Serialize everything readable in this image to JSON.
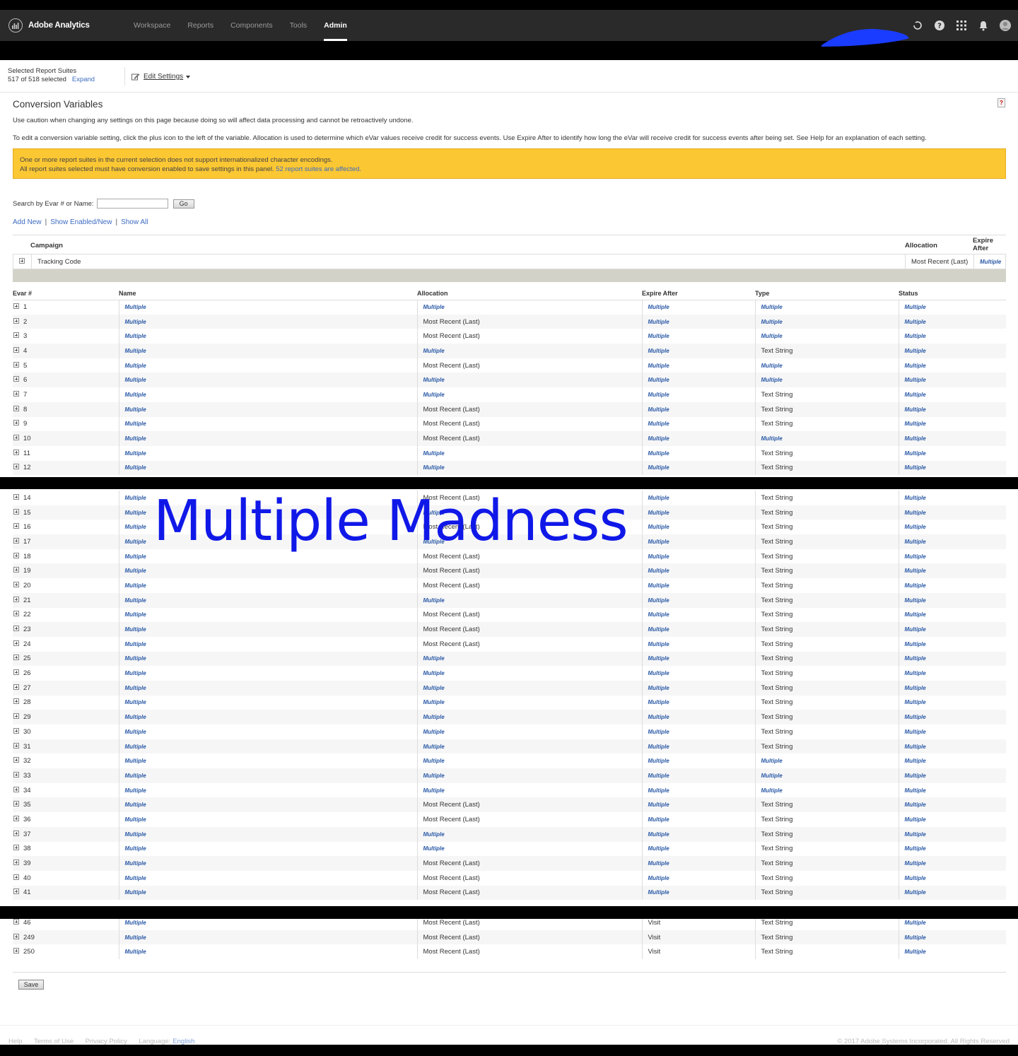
{
  "app": {
    "brand": "Adobe Analytics",
    "nav": [
      "Workspace",
      "Reports",
      "Components",
      "Tools",
      "Admin"
    ],
    "active_nav": "Admin",
    "icons": [
      "help-icon",
      "apps-grid-icon",
      "bell-icon",
      "avatar-icon"
    ]
  },
  "suites": {
    "label": "Selected Report Suites",
    "count": "517 of 518 selected",
    "expand": "Expand",
    "edit_settings": "Edit Settings"
  },
  "page": {
    "title": "Conversion Variables",
    "caution": "Use caution when changing any settings on this page because doing so will affect data processing and cannot be retroactively undone.",
    "instructions": "To edit a conversion variable setting, click the plus icon to the left of the variable. Allocation is used to determine which eVar values receive credit for success events. Use Expire After to identify how long the eVar will receive credit for success events after being set. See Help for an explanation of each setting.",
    "warning_line1": "One or more report suites in the current selection does not support internationalized character encodings.",
    "warning_line2": "All report suites selected must have conversion enabled to save settings in this panel.",
    "warning_link": "52 report suites are affected.",
    "search_label": "Search by Evar # or Name:",
    "go": "Go",
    "add_new": "Add New",
    "show_enabled": "Show Enabled/New",
    "show_all": "Show All"
  },
  "campaign": {
    "headers": {
      "campaign": "Campaign",
      "allocation": "Allocation",
      "expire": "Expire After"
    },
    "row": {
      "name": "Tracking Code",
      "allocation": "Most Recent (Last)",
      "expire": "Multiple"
    }
  },
  "table": {
    "headers": {
      "num": "Evar #",
      "name": "Name",
      "allocation": "Allocation",
      "expire": "Expire After",
      "type": "Type",
      "status": "Status"
    },
    "section1": [
      [
        "1",
        "Multiple",
        "Multiple",
        "Multiple",
        "Multiple",
        "Multiple"
      ],
      [
        "2",
        "Multiple",
        "Most Recent (Last)",
        "Multiple",
        "Multiple",
        "Multiple"
      ],
      [
        "3",
        "Multiple",
        "Most Recent (Last)",
        "Multiple",
        "Multiple",
        "Multiple"
      ],
      [
        "4",
        "Multiple",
        "Multiple",
        "Multiple",
        "Text String",
        "Multiple"
      ],
      [
        "5",
        "Multiple",
        "Most Recent (Last)",
        "Multiple",
        "Multiple",
        "Multiple"
      ],
      [
        "6",
        "Multiple",
        "Multiple",
        "Multiple",
        "Multiple",
        "Multiple"
      ],
      [
        "7",
        "Multiple",
        "Multiple",
        "Multiple",
        "Text String",
        "Multiple"
      ],
      [
        "8",
        "Multiple",
        "Most Recent (Last)",
        "Multiple",
        "Text String",
        "Multiple"
      ],
      [
        "9",
        "Multiple",
        "Most Recent (Last)",
        "Multiple",
        "Text String",
        "Multiple"
      ],
      [
        "10",
        "Multiple",
        "Most Recent (Last)",
        "Multiple",
        "Multiple",
        "Multiple"
      ],
      [
        "11",
        "Multiple",
        "Multiple",
        "Multiple",
        "Text String",
        "Multiple"
      ],
      [
        "12",
        "Multiple",
        "Multiple",
        "Multiple",
        "Text String",
        "Multiple"
      ]
    ],
    "section2": [
      [
        "14",
        "Multiple",
        "Most Recent (Last)",
        "Multiple",
        "Text String",
        "Multiple"
      ],
      [
        "15",
        "Multiple",
        "Multiple",
        "Multiple",
        "Text String",
        "Multiple"
      ],
      [
        "16",
        "Multiple",
        "Most Recent (Last)",
        "Multiple",
        "Text String",
        "Multiple"
      ],
      [
        "17",
        "Multiple",
        "Multiple",
        "Multiple",
        "Text String",
        "Multiple"
      ],
      [
        "18",
        "Multiple",
        "Most Recent (Last)",
        "Multiple",
        "Text String",
        "Multiple"
      ],
      [
        "19",
        "Multiple",
        "Most Recent (Last)",
        "Multiple",
        "Text String",
        "Multiple"
      ],
      [
        "20",
        "Multiple",
        "Most Recent (Last)",
        "Multiple",
        "Text String",
        "Multiple"
      ],
      [
        "21",
        "Multiple",
        "Multiple",
        "Multiple",
        "Text String",
        "Multiple"
      ],
      [
        "22",
        "Multiple",
        "Most Recent (Last)",
        "Multiple",
        "Text String",
        "Multiple"
      ],
      [
        "23",
        "Multiple",
        "Most Recent (Last)",
        "Multiple",
        "Text String",
        "Multiple"
      ],
      [
        "24",
        "Multiple",
        "Most Recent (Last)",
        "Multiple",
        "Text String",
        "Multiple"
      ],
      [
        "25",
        "Multiple",
        "Multiple",
        "Multiple",
        "Text String",
        "Multiple"
      ],
      [
        "26",
        "Multiple",
        "Multiple",
        "Multiple",
        "Text String",
        "Multiple"
      ],
      [
        "27",
        "Multiple",
        "Multiple",
        "Multiple",
        "Text String",
        "Multiple"
      ],
      [
        "28",
        "Multiple",
        "Multiple",
        "Multiple",
        "Text String",
        "Multiple"
      ],
      [
        "29",
        "Multiple",
        "Multiple",
        "Multiple",
        "Text String",
        "Multiple"
      ],
      [
        "30",
        "Multiple",
        "Multiple",
        "Multiple",
        "Text String",
        "Multiple"
      ],
      [
        "31",
        "Multiple",
        "Multiple",
        "Multiple",
        "Text String",
        "Multiple"
      ],
      [
        "32",
        "Multiple",
        "Multiple",
        "Multiple",
        "Multiple",
        "Multiple"
      ],
      [
        "33",
        "Multiple",
        "Multiple",
        "Multiple",
        "Multiple",
        "Multiple"
      ],
      [
        "34",
        "Multiple",
        "Multiple",
        "Multiple",
        "Multiple",
        "Multiple"
      ],
      [
        "35",
        "Multiple",
        "Most Recent (Last)",
        "Multiple",
        "Text String",
        "Multiple"
      ],
      [
        "36",
        "Multiple",
        "Most Recent (Last)",
        "Multiple",
        "Text String",
        "Multiple"
      ],
      [
        "37",
        "Multiple",
        "Multiple",
        "Multiple",
        "Text String",
        "Multiple"
      ],
      [
        "38",
        "Multiple",
        "Multiple",
        "Multiple",
        "Text String",
        "Multiple"
      ],
      [
        "39",
        "Multiple",
        "Most Recent (Last)",
        "Multiple",
        "Text String",
        "Multiple"
      ],
      [
        "40",
        "Multiple",
        "Most Recent (Last)",
        "Multiple",
        "Text String",
        "Multiple"
      ],
      [
        "41",
        "Multiple",
        "Most Recent (Last)",
        "Multiple",
        "Text String",
        "Multiple"
      ]
    ],
    "section3": [
      [
        "46",
        "Multiple",
        "Most Recent (Last)",
        "Visit",
        "Text String",
        "Multiple"
      ],
      [
        "249",
        "Multiple",
        "Most Recent (Last)",
        "Visit",
        "Text String",
        "Multiple"
      ],
      [
        "250",
        "Multiple",
        "Most Recent (Last)",
        "Visit",
        "Text String",
        "Multiple"
      ]
    ],
    "save": "Save"
  },
  "overlay_text": "Multiple Madness",
  "footer": {
    "links": [
      "Help",
      "Terms of Use",
      "Privacy Policy"
    ],
    "language_label": "Language:",
    "language": "English",
    "copyright": "© 2017 Adobe Systems Incorporated. All Rights Reserved"
  },
  "colors": {
    "nav_bg": "#2a2a2a",
    "link": "#3d6cc2",
    "warning_bg": "#fbc733",
    "overlay": "#1018e8",
    "scribble": "#1a3cff"
  }
}
